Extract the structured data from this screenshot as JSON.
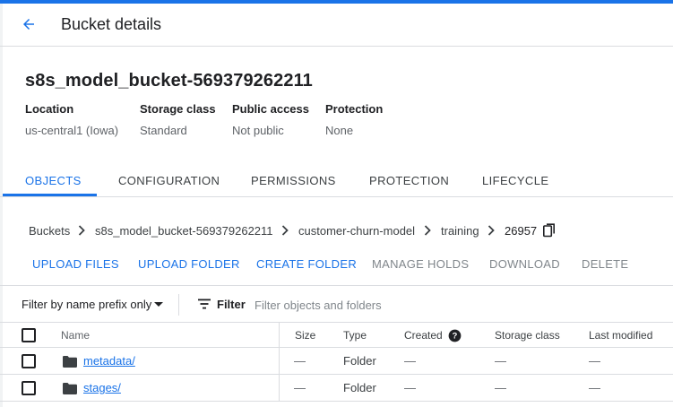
{
  "header": {
    "title": "Bucket details",
    "back_icon": "arrow-back-icon"
  },
  "bucket": {
    "name": "s8s_model_bucket-569379262211",
    "meta": [
      {
        "label": "Location",
        "value": "us-central1 (Iowa)"
      },
      {
        "label": "Storage class",
        "value": "Standard"
      },
      {
        "label": "Public access",
        "value": "Not public"
      },
      {
        "label": "Protection",
        "value": "None"
      }
    ]
  },
  "tabs": [
    {
      "label": "OBJECTS",
      "active": true
    },
    {
      "label": "CONFIGURATION",
      "active": false
    },
    {
      "label": "PERMISSIONS",
      "active": false
    },
    {
      "label": "PROTECTION",
      "active": false
    },
    {
      "label": "LIFECYCLE",
      "active": false
    }
  ],
  "breadcrumb": [
    "Buckets",
    "s8s_model_bucket-569379262211",
    "customer-churn-model",
    "training",
    "26957"
  ],
  "actions": [
    {
      "label": "UPLOAD FILES",
      "enabled": true
    },
    {
      "label": "UPLOAD FOLDER",
      "enabled": true
    },
    {
      "label": "CREATE FOLDER",
      "enabled": true
    },
    {
      "label": "MANAGE HOLDS",
      "enabled": false
    },
    {
      "label": "DOWNLOAD",
      "enabled": false
    },
    {
      "label": "DELETE",
      "enabled": false
    }
  ],
  "filter": {
    "prefix_label": "Filter by name prefix only",
    "filter_label": "Filter",
    "placeholder": "Filter objects and folders"
  },
  "table": {
    "columns": [
      "Name",
      "Size",
      "Type",
      "Created",
      "Storage class",
      "Last modified"
    ],
    "rows": [
      {
        "name": "metadata/",
        "size": "—",
        "type": "Folder",
        "created": "—",
        "storage_class": "—",
        "last_modified": "—"
      },
      {
        "name": "stages/",
        "size": "—",
        "type": "Folder",
        "created": "—",
        "storage_class": "—",
        "last_modified": "—"
      }
    ]
  },
  "colors": {
    "accent": "#1a73e8",
    "text": "#202124",
    "muted": "#5f6368",
    "disabled": "#80868b",
    "divider": "#dadce0"
  }
}
